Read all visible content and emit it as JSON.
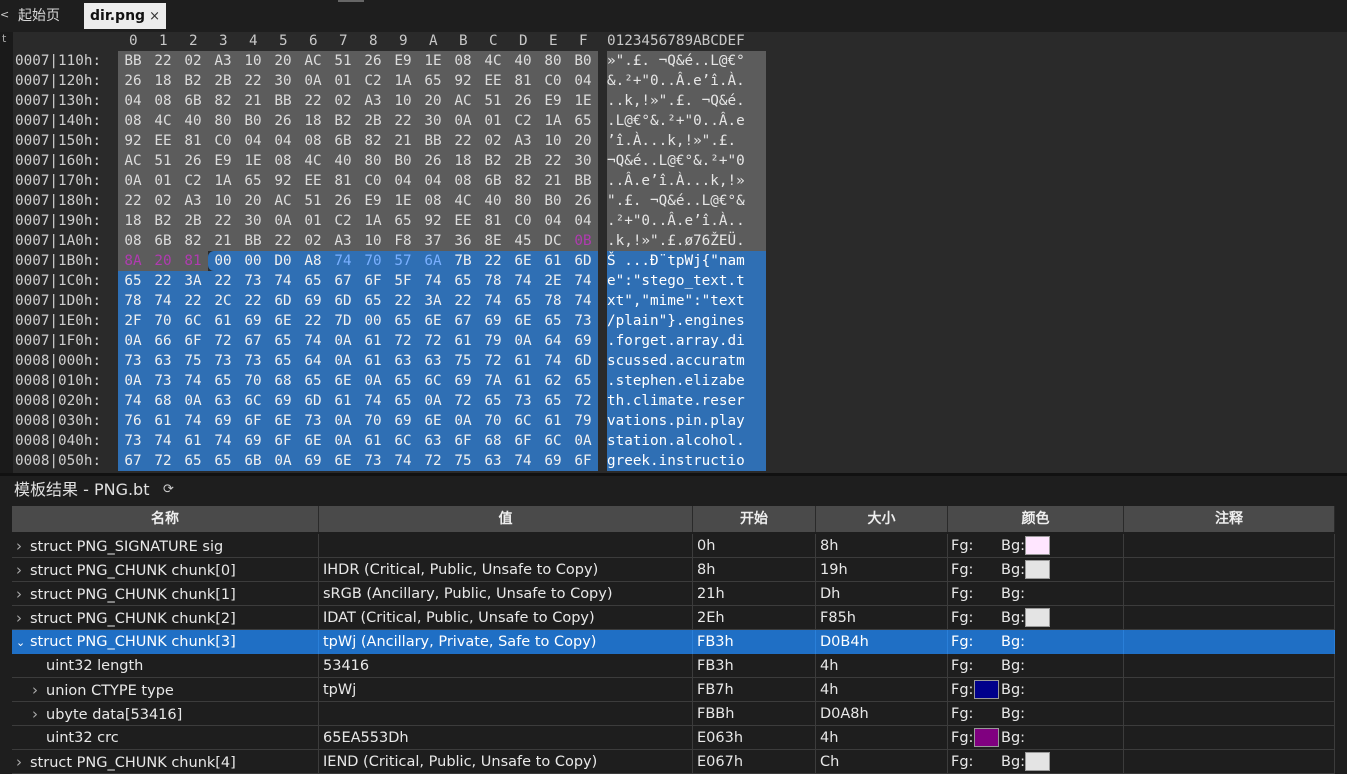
{
  "tabs": {
    "home": "起始页",
    "active": "dir.png",
    "close": "×",
    "back": "<"
  },
  "left_strip_char": "t",
  "hex": {
    "col_headers": [
      "0",
      "1",
      "2",
      "3",
      "4",
      "5",
      "6",
      "7",
      "8",
      "9",
      "A",
      "B",
      "C",
      "D",
      "E",
      "F"
    ],
    "ascii_header": "0123456789ABCDEF",
    "rows": [
      {
        "addr": "0007|110h:",
        "bytes": [
          "BB",
          "22",
          "02",
          "A3",
          "10",
          "20",
          "AC",
          "51",
          "26",
          "E9",
          "1E",
          "08",
          "4C",
          "40",
          "80",
          "B0"
        ],
        "ascii": "»\".£. ¬Q&é..L@€°"
      },
      {
        "addr": "0007|120h:",
        "bytes": [
          "26",
          "18",
          "B2",
          "2B",
          "22",
          "30",
          "0A",
          "01",
          "C2",
          "1A",
          "65",
          "92",
          "EE",
          "81",
          "C0",
          "04"
        ],
        "ascii": "&.²+\"0..Â.e’î.À."
      },
      {
        "addr": "0007|130h:",
        "bytes": [
          "04",
          "08",
          "6B",
          "82",
          "21",
          "BB",
          "22",
          "02",
          "A3",
          "10",
          "20",
          "AC",
          "51",
          "26",
          "E9",
          "1E"
        ],
        "ascii": "..k‚!»\".£. ¬Q&é."
      },
      {
        "addr": "0007|140h:",
        "bytes": [
          "08",
          "4C",
          "40",
          "80",
          "B0",
          "26",
          "18",
          "B2",
          "2B",
          "22",
          "30",
          "0A",
          "01",
          "C2",
          "1A",
          "65"
        ],
        "ascii": ".L@€°&.²+\"0..Â.e"
      },
      {
        "addr": "0007|150h:",
        "bytes": [
          "92",
          "EE",
          "81",
          "C0",
          "04",
          "04",
          "08",
          "6B",
          "82",
          "21",
          "BB",
          "22",
          "02",
          "A3",
          "10",
          "20"
        ],
        "ascii": "’î.À...k‚!»\".£. "
      },
      {
        "addr": "0007|160h:",
        "bytes": [
          "AC",
          "51",
          "26",
          "E9",
          "1E",
          "08",
          "4C",
          "40",
          "80",
          "B0",
          "26",
          "18",
          "B2",
          "2B",
          "22",
          "30"
        ],
        "ascii": "¬Q&é..L@€°&.²+\"0"
      },
      {
        "addr": "0007|170h:",
        "bytes": [
          "0A",
          "01",
          "C2",
          "1A",
          "65",
          "92",
          "EE",
          "81",
          "C0",
          "04",
          "04",
          "08",
          "6B",
          "82",
          "21",
          "BB"
        ],
        "ascii": "..Â.e’î.À...k‚!»"
      },
      {
        "addr": "0007|180h:",
        "bytes": [
          "22",
          "02",
          "A3",
          "10",
          "20",
          "AC",
          "51",
          "26",
          "E9",
          "1E",
          "08",
          "4C",
          "40",
          "80",
          "B0",
          "26"
        ],
        "ascii": "\".£. ¬Q&é..L@€°&"
      },
      {
        "addr": "0007|190h:",
        "bytes": [
          "18",
          "B2",
          "2B",
          "22",
          "30",
          "0A",
          "01",
          "C2",
          "1A",
          "65",
          "92",
          "EE",
          "81",
          "C0",
          "04",
          "04"
        ],
        "ascii": ".²+\"0..Â.e’î.À.."
      },
      {
        "addr": "0007|1A0h:",
        "bytes": [
          "08",
          "6B",
          "82",
          "21",
          "BB",
          "22",
          "02",
          "A3",
          "10",
          "F8",
          "37",
          "36",
          "8E",
          "45",
          "DC",
          "0B"
        ],
        "ascii": ".k‚!»\".£.ø76ŽEÜ."
      },
      {
        "addr": "0007|1B0h:",
        "bytes": [
          "8A",
          "20",
          "81",
          "00",
          "00",
          "D0",
          "A8",
          "74",
          "70",
          "57",
          "6A",
          "7B",
          "22",
          "6E",
          "61",
          "6D"
        ],
        "ascii": "Š ...Ð¨tpWj{\"nam"
      },
      {
        "addr": "0007|1C0h:",
        "bytes": [
          "65",
          "22",
          "3A",
          "22",
          "73",
          "74",
          "65",
          "67",
          "6F",
          "5F",
          "74",
          "65",
          "78",
          "74",
          "2E",
          "74"
        ],
        "ascii": "e\":\"stego_text.t"
      },
      {
        "addr": "0007|1D0h:",
        "bytes": [
          "78",
          "74",
          "22",
          "2C",
          "22",
          "6D",
          "69",
          "6D",
          "65",
          "22",
          "3A",
          "22",
          "74",
          "65",
          "78",
          "74"
        ],
        "ascii": "xt\",\"mime\":\"text"
      },
      {
        "addr": "0007|1E0h:",
        "bytes": [
          "2F",
          "70",
          "6C",
          "61",
          "69",
          "6E",
          "22",
          "7D",
          "00",
          "65",
          "6E",
          "67",
          "69",
          "6E",
          "65",
          "73"
        ],
        "ascii": "/plain\"}.engines"
      },
      {
        "addr": "0007|1F0h:",
        "bytes": [
          "0A",
          "66",
          "6F",
          "72",
          "67",
          "65",
          "74",
          "0A",
          "61",
          "72",
          "72",
          "61",
          "79",
          "0A",
          "64",
          "69"
        ],
        "ascii": ".forget.array.di"
      },
      {
        "addr": "0008|000h:",
        "bytes": [
          "73",
          "63",
          "75",
          "73",
          "73",
          "65",
          "64",
          "0A",
          "61",
          "63",
          "63",
          "75",
          "72",
          "61",
          "74",
          "6D"
        ],
        "ascii": "scussed.accuratm"
      },
      {
        "addr": "0008|010h:",
        "bytes": [
          "0A",
          "73",
          "74",
          "65",
          "70",
          "68",
          "65",
          "6E",
          "0A",
          "65",
          "6C",
          "69",
          "7A",
          "61",
          "62",
          "65"
        ],
        "ascii": ".stephen.elizabe"
      },
      {
        "addr": "0008|020h:",
        "bytes": [
          "74",
          "68",
          "0A",
          "63",
          "6C",
          "69",
          "6D",
          "61",
          "74",
          "65",
          "0A",
          "72",
          "65",
          "73",
          "65",
          "72"
        ],
        "ascii": "th.climate.reser"
      },
      {
        "addr": "0008|030h:",
        "bytes": [
          "76",
          "61",
          "74",
          "69",
          "6F",
          "6E",
          "73",
          "0A",
          "70",
          "69",
          "6E",
          "0A",
          "70",
          "6C",
          "61",
          "79"
        ],
        "ascii": "vations.pin.play"
      },
      {
        "addr": "0008|040h:",
        "bytes": [
          "73",
          "74",
          "61",
          "74",
          "69",
          "6F",
          "6E",
          "0A",
          "61",
          "6C",
          "63",
          "6F",
          "68",
          "6F",
          "6C",
          "0A"
        ],
        "ascii": "station.alcohol."
      },
      {
        "addr": "0008|050h:",
        "bytes": [
          "67",
          "72",
          "65",
          "65",
          "6B",
          "0A",
          "69",
          "6E",
          "73",
          "74",
          "72",
          "75",
          "63",
          "74",
          "69",
          "6F"
        ],
        "ascii": "greek.instructio"
      }
    ]
  },
  "template": {
    "title": "模板结果 - PNG.bt",
    "refresh_icon": "⟳"
  },
  "table": {
    "headers": [
      "名称",
      "值",
      "开始",
      "大小",
      "颜色",
      "注释"
    ],
    "rows": [
      {
        "name": "struct PNG_SIGNATURE sig",
        "value": "",
        "start": "0h",
        "size": "8h",
        "fg": "Fg:",
        "bg": "Bg:",
        "indent": 0,
        "expand": "closed",
        "fg_swatch": "",
        "bg_swatch": "#ffe6ff"
      },
      {
        "name": "struct PNG_CHUNK chunk[0]",
        "value": "IHDR  (Critical, Public, Unsafe to Copy)",
        "start": "8h",
        "size": "19h",
        "fg": "Fg:",
        "bg": "Bg:",
        "indent": 0,
        "expand": "closed",
        "fg_swatch": "",
        "bg_swatch": "#e4e4e4"
      },
      {
        "name": "struct PNG_CHUNK chunk[1]",
        "value": "sRGB  (Ancillary, Public, Unsafe to Copy)",
        "start": "21h",
        "size": "Dh",
        "fg": "Fg:",
        "bg": "Bg:",
        "indent": 0,
        "expand": "closed",
        "fg_swatch": "",
        "bg_swatch": ""
      },
      {
        "name": "struct PNG_CHUNK chunk[2]",
        "value": "IDAT  (Critical, Public, Unsafe to Copy)",
        "start": "2Eh",
        "size": "F85h",
        "fg": "Fg:",
        "bg": "Bg:",
        "indent": 0,
        "expand": "closed",
        "fg_swatch": "",
        "bg_swatch": "#e4e4e4"
      },
      {
        "name": "struct PNG_CHUNK chunk[3]",
        "value": "tpWj  (Ancillary, Private, Safe to Copy)",
        "start": "FB3h",
        "size": "D0B4h",
        "fg": "Fg:",
        "bg": "Bg:",
        "indent": 0,
        "expand": "open",
        "fg_swatch": "",
        "bg_swatch": "",
        "selected": true
      },
      {
        "name": "uint32 length",
        "value": "53416",
        "start": "FB3h",
        "size": "4h",
        "fg": "Fg:",
        "bg": "Bg:",
        "indent": 1,
        "expand": "none",
        "fg_swatch": "",
        "bg_swatch": ""
      },
      {
        "name": "union CTYPE type",
        "value": "tpWj",
        "start": "FB7h",
        "size": "4h",
        "fg": "Fg:",
        "bg": "Bg:",
        "indent": 1,
        "expand": "closed",
        "fg_swatch": "#00008b",
        "bg_swatch": ""
      },
      {
        "name": "ubyte data[53416]",
        "value": "",
        "start": "FBBh",
        "size": "D0A8h",
        "fg": "Fg:",
        "bg": "Bg:",
        "indent": 1,
        "expand": "closed",
        "fg_swatch": "",
        "bg_swatch": ""
      },
      {
        "name": "uint32 crc",
        "value": "65EA553Dh",
        "start": "E063h",
        "size": "4h",
        "fg": "Fg:",
        "bg": "Bg:",
        "indent": 1,
        "expand": "none",
        "fg_swatch": "#800080",
        "bg_swatch": ""
      },
      {
        "name": "struct PNG_CHUNK chunk[4]",
        "value": "IEND  (Critical, Public, Unsafe to Copy)",
        "start": "E067h",
        "size": "Ch",
        "fg": "Fg:",
        "bg": "Bg:",
        "indent": 0,
        "expand": "closed",
        "fg_swatch": "",
        "bg_swatch": "#e4e4e4"
      }
    ]
  },
  "colors": {
    "selection": "#2f6fb4",
    "gray_region": "#5c5c5c",
    "row_selected": "#1f6fc5",
    "magenta_byte": "#b03bb0",
    "lightblue_byte": "#7ab0ff"
  }
}
